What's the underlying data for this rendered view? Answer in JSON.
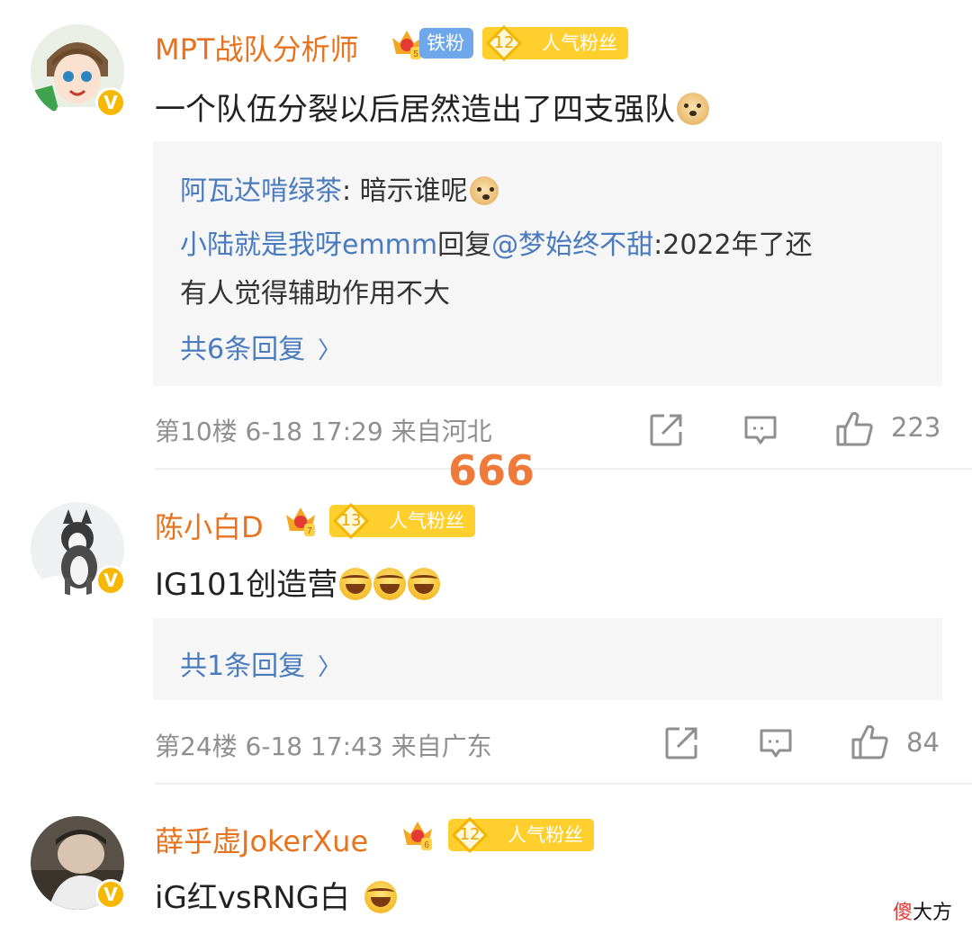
{
  "comments": [
    {
      "username": "MPT战队分析师",
      "badge_crown_level": "5",
      "badge_iron": "铁粉",
      "fan_level": "12",
      "fan_label": "人气粉丝",
      "content": "一个队伍分裂以后居然造出了四支强队",
      "content_emoji": "doge-emoji",
      "replies": [
        {
          "user": "阿瓦达啃绿茶",
          "text": ": 暗示谁呢",
          "emoji": "doge-emoji"
        },
        {
          "user": "小陆就是我呀emmm",
          "text_prefix": "回复",
          "mention": "@梦始终不甜",
          "text": ":2022年了还",
          "text_line2": "有人觉得辅助作用不大"
        }
      ],
      "more_replies": "共6条回复",
      "meta": "第10楼  6-18 17:29  来自河北",
      "likes": "223"
    },
    {
      "username": "陈小白D",
      "badge_crown_level": "7",
      "fan_level": "13",
      "fan_label": "人气粉丝",
      "content": "IG101创造营",
      "content_emoji": "laugh-emoji",
      "more_replies": "共1条回复",
      "meta": "第24楼  6-18 17:43  来自广东",
      "likes": "84"
    },
    {
      "username": "薛乎虚JokerXue",
      "badge_crown_level": "6",
      "fan_level": "12",
      "fan_label": "人气粉丝",
      "content": "iG红vsRNG白",
      "content_emoji": "laugh-emoji"
    }
  ],
  "overlay_text": "666",
  "watermark": {
    "part1": "傻",
    "part2": "大方"
  },
  "colors": {
    "username": "#e8731e",
    "link": "#4a7bbf",
    "meta": "#8f8f8f",
    "fan_badge": "#ffcf2e",
    "iron_badge": "#6fa8ea",
    "verify": "#f6b800"
  }
}
